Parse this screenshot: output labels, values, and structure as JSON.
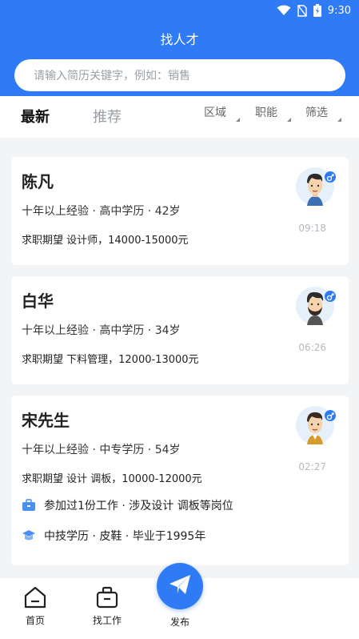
{
  "status_bar": {
    "time": "9:30"
  },
  "header": {
    "title": "找人才",
    "search_placeholder": "请输入简历关键字，例如：销售"
  },
  "tabs": [
    {
      "label": "最新",
      "active": true
    },
    {
      "label": "推荐",
      "active": false
    }
  ],
  "filters": [
    {
      "label": "区域"
    },
    {
      "label": "职能"
    },
    {
      "label": "筛选"
    }
  ],
  "candidates": [
    {
      "name": "陈凡",
      "info": "十年以上经验 · 高中学历 · 42岁",
      "expectation": "求职期望 设计师，14000-15000元",
      "time": "09:18",
      "gender_icon": "male-icon"
    },
    {
      "name": "白华",
      "info": "十年以上经验 · 高中学历 · 34岁",
      "expectation": "求职期望 下料管理，12000-13000元",
      "time": "06:26",
      "gender_icon": "male-icon"
    },
    {
      "name": "宋先生",
      "info": "十年以上经验 · 中专学历 · 54岁",
      "expectation": "求职期望 设计 调板，10000-12000元",
      "time": "02:27",
      "gender_icon": "male-icon",
      "work_experience": "参加过1份工作 · 涉及设计 调板等岗位",
      "education": "中技学历 · 皮鞋 · 毕业于1995年"
    }
  ],
  "bottom_nav": [
    {
      "label": "首页",
      "icon": "home-icon"
    },
    {
      "label": "找工作",
      "icon": "briefcase-icon"
    },
    {
      "label": "发布",
      "icon": "send-icon"
    }
  ],
  "colors": {
    "primary": "#2f7bf5",
    "background": "#f3f4f6",
    "muted_text": "#9aa0a6"
  }
}
